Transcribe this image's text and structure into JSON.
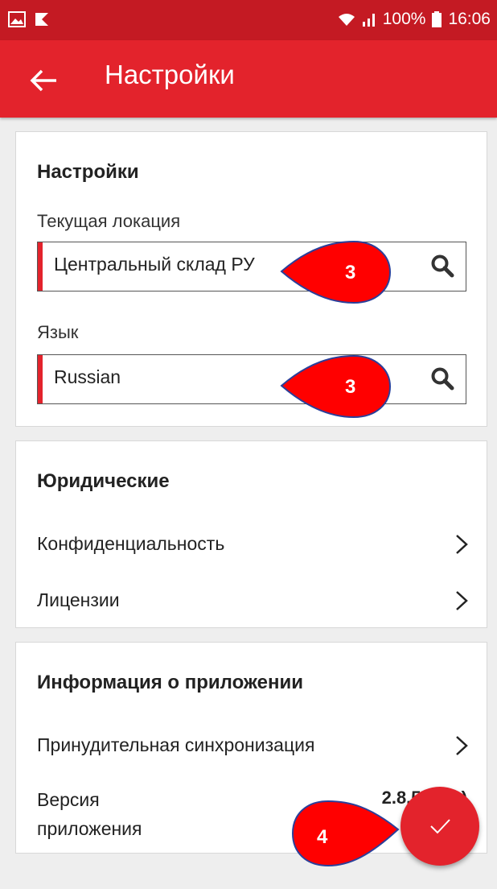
{
  "status": {
    "signal_text": "100%",
    "time": "16:06"
  },
  "appbar": {
    "title": "Настройки"
  },
  "settings": {
    "heading": "Настройки",
    "location_label": "Текущая локация",
    "location_value": "Центральный склад РУ",
    "language_label": "Язык",
    "language_value": "Russian"
  },
  "legal": {
    "heading": "Юридические",
    "privacy": "Конфиденциальность",
    "licenses": "Лицензии"
  },
  "appinfo": {
    "heading": "Информация о приложении",
    "force_sync": "Принудительная синхронизация",
    "version_label": "Версия приложения",
    "version_value": "2.8.5 (139)"
  },
  "callouts": {
    "c1": "3",
    "c2": "3",
    "c3": "4"
  },
  "colors": {
    "accent": "#e3232c",
    "statusbar": "#c41a23",
    "callout": "#ff0000",
    "callout_outline": "#2a3f9a"
  }
}
